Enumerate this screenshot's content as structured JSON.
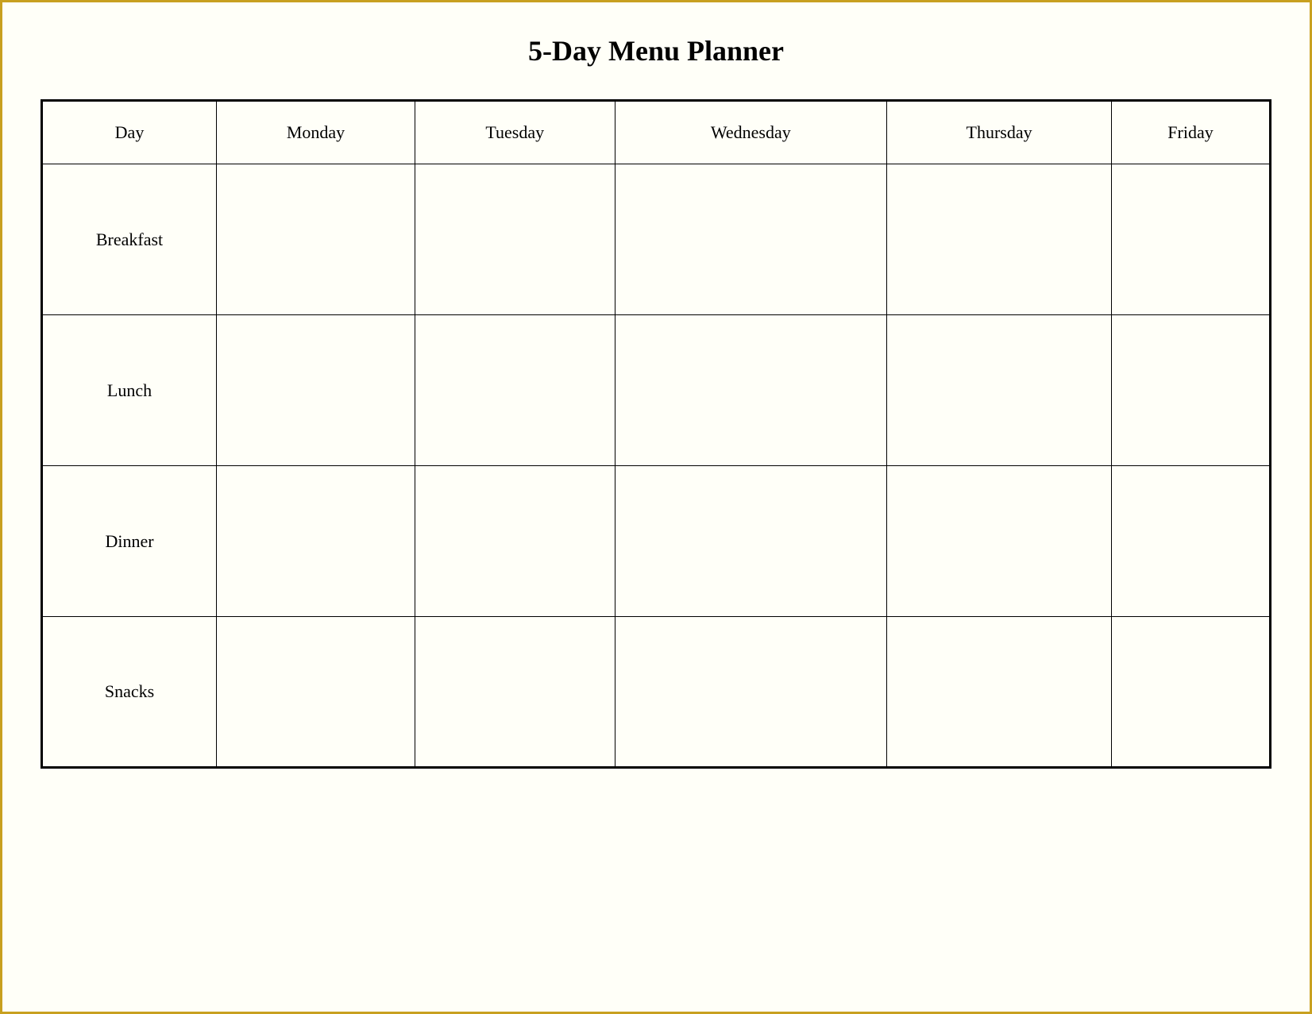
{
  "title": "5-Day Menu Planner",
  "table": {
    "headers": [
      "Day",
      "Monday",
      "Tuesday",
      "Wednesday",
      "Thursday",
      "Friday"
    ],
    "rows": [
      {
        "label": "Breakfast",
        "cells": [
          "",
          "",
          "",
          "",
          ""
        ]
      },
      {
        "label": "Lunch",
        "cells": [
          "",
          "",
          "",
          "",
          ""
        ]
      },
      {
        "label": "Dinner",
        "cells": [
          "",
          "",
          "",
          "",
          ""
        ]
      },
      {
        "label": "Snacks",
        "cells": [
          "",
          "",
          "",
          "",
          ""
        ]
      }
    ]
  }
}
